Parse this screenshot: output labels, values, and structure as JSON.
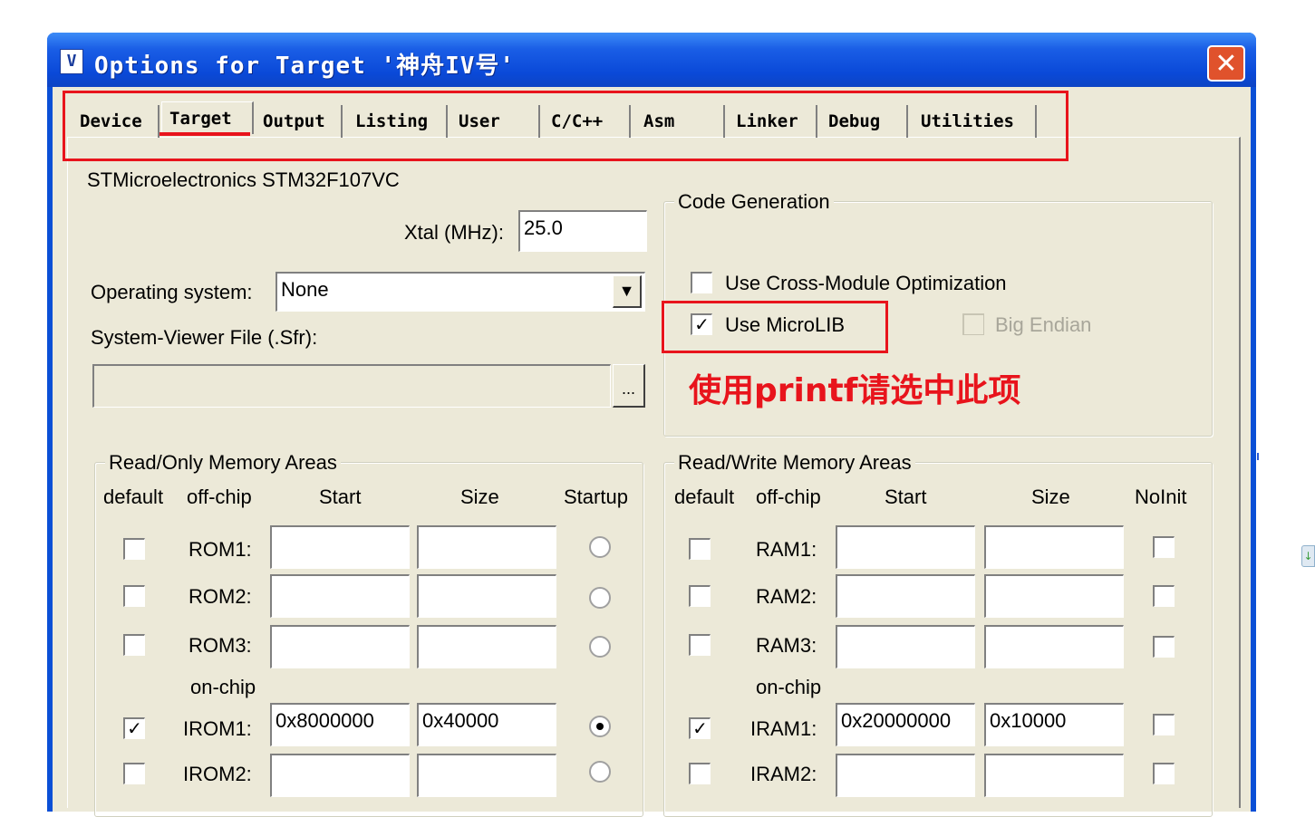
{
  "window": {
    "title": "Options for Target '神舟IV号'",
    "icon_letter": "V",
    "close_glyph": "✕"
  },
  "tabs": [
    "Device",
    "Target",
    "Output",
    "Listing",
    "User",
    "C/C++",
    "Asm",
    "Linker",
    "Debug",
    "Utilities"
  ],
  "active_tab": "Target",
  "device_name": "STMicroelectronics STM32F107VC",
  "xtal": {
    "label": "Xtal (MHz):",
    "value": "25.0"
  },
  "os": {
    "label": "Operating system:",
    "value": "None",
    "arrow": "▼"
  },
  "sfr": {
    "label": "System-Viewer File (.Sfr):",
    "value": "",
    "browse": "..."
  },
  "code_gen": {
    "title": "Code Generation",
    "cross_module": {
      "label": "Use Cross-Module Optimization",
      "checked": false
    },
    "microlib": {
      "label": "Use MicroLIB",
      "checked": true
    },
    "big_endian": {
      "label": "Big Endian",
      "checked": false,
      "disabled": true
    }
  },
  "annotation": "使用printf请选中此项",
  "check_glyph": "✓",
  "rom": {
    "title": "Read/Only Memory Areas",
    "headers": [
      "default",
      "off-chip",
      "Start",
      "Size",
      "Startup"
    ],
    "onchip_label": "on-chip",
    "rows": [
      {
        "name": "ROM1:",
        "checked": false,
        "start": "",
        "size": "",
        "startup": false
      },
      {
        "name": "ROM2:",
        "checked": false,
        "start": "",
        "size": "",
        "startup": false
      },
      {
        "name": "ROM3:",
        "checked": false,
        "start": "",
        "size": "",
        "startup": false
      },
      {
        "name": "IROM1:",
        "checked": true,
        "start": "0x8000000",
        "size": "0x40000",
        "startup": true
      },
      {
        "name": "IROM2:",
        "checked": false,
        "start": "",
        "size": "",
        "startup": false
      }
    ]
  },
  "ram": {
    "title": "Read/Write Memory Areas",
    "headers": [
      "default",
      "off-chip",
      "Start",
      "Size",
      "NoInit"
    ],
    "onchip_label": "on-chip",
    "rows": [
      {
        "name": "RAM1:",
        "checked": false,
        "start": "",
        "size": "",
        "noinit": false
      },
      {
        "name": "RAM2:",
        "checked": false,
        "start": "",
        "size": "",
        "noinit": false
      },
      {
        "name": "RAM3:",
        "checked": false,
        "start": "",
        "size": "",
        "noinit": false
      },
      {
        "name": "IRAM1:",
        "checked": true,
        "start": "0x20000000",
        "size": "0x10000",
        "noinit": false
      },
      {
        "name": "IRAM2:",
        "checked": false,
        "start": "",
        "size": "",
        "noinit": false
      }
    ]
  }
}
